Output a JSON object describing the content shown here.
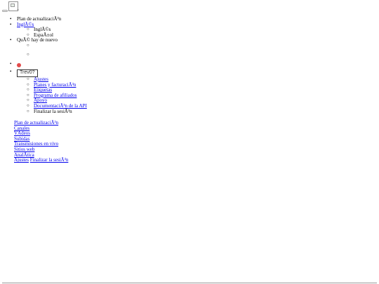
{
  "header": {
    "menu_tilde": "~"
  },
  "nav": {
    "upgrade": "Plan de actualizaciÃ³n",
    "language": {
      "current": "InglÃ©s",
      "options": [
        "InglÃ©s",
        "EspaÃ±ol"
      ]
    },
    "whats_new": "QuÃ© hay de nuevo",
    "user": {
      "button": "Trev0?",
      "menu": [
        "Ajustes",
        "Planes y facturaciÃ³n",
        "Etiquetas",
        "Programa de afiliados",
        "Apoyo",
        "DocumentaciÃ³n de la API"
      ],
      "logout": "Finalizar la sesiÃ³n"
    }
  },
  "footer": {
    "links": [
      "Plan de actualizaciÃ³n",
      "Canales",
      "VÃ­deos",
      "Subidas",
      "Transmisiones en vivo",
      "Sitios web",
      "AnalÃ­tica"
    ],
    "settings": "Ajustes",
    "logout": "Finalizar la sesiÃ³n"
  },
  "colors": {
    "link": "#0000ee",
    "badge": "#e34a4a",
    "rule": "#9a9a9a"
  }
}
